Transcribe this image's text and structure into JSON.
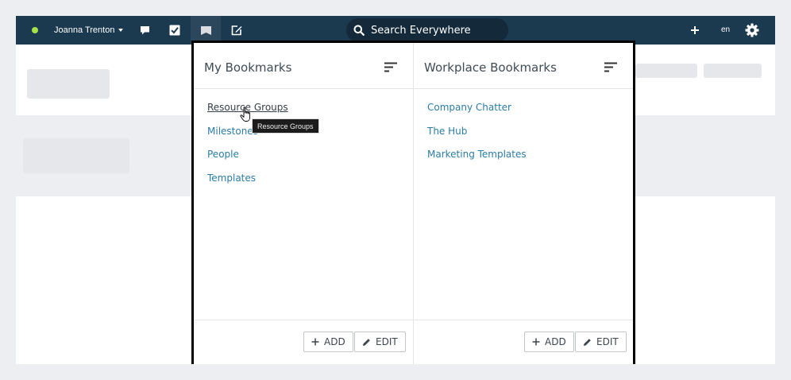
{
  "topbar": {
    "user_name": "Joanna Trenton",
    "search_placeholder": "Search Everywhere",
    "language": "en",
    "status_color": "#a6e04a",
    "background_color": "#1b3a50",
    "icons": [
      "chat-icon",
      "tasks-checkbox-icon",
      "bookmarks-icon",
      "compose-icon",
      "plus-icon",
      "gear-icon"
    ]
  },
  "panel": {
    "my_bookmarks": {
      "title": "My Bookmarks",
      "items": [
        "Resource Groups",
        "Milestones",
        "People",
        "Templates"
      ],
      "add_label": "ADD",
      "edit_label": "EDIT"
    },
    "workplace_bookmarks": {
      "title": "Workplace Bookmarks",
      "items": [
        "Company Chatter",
        "The Hub",
        "Marketing Templates"
      ],
      "add_label": "ADD",
      "edit_label": "EDIT"
    },
    "link_color": "#2b7ca6"
  },
  "tooltip": {
    "text": "Resource Groups"
  }
}
